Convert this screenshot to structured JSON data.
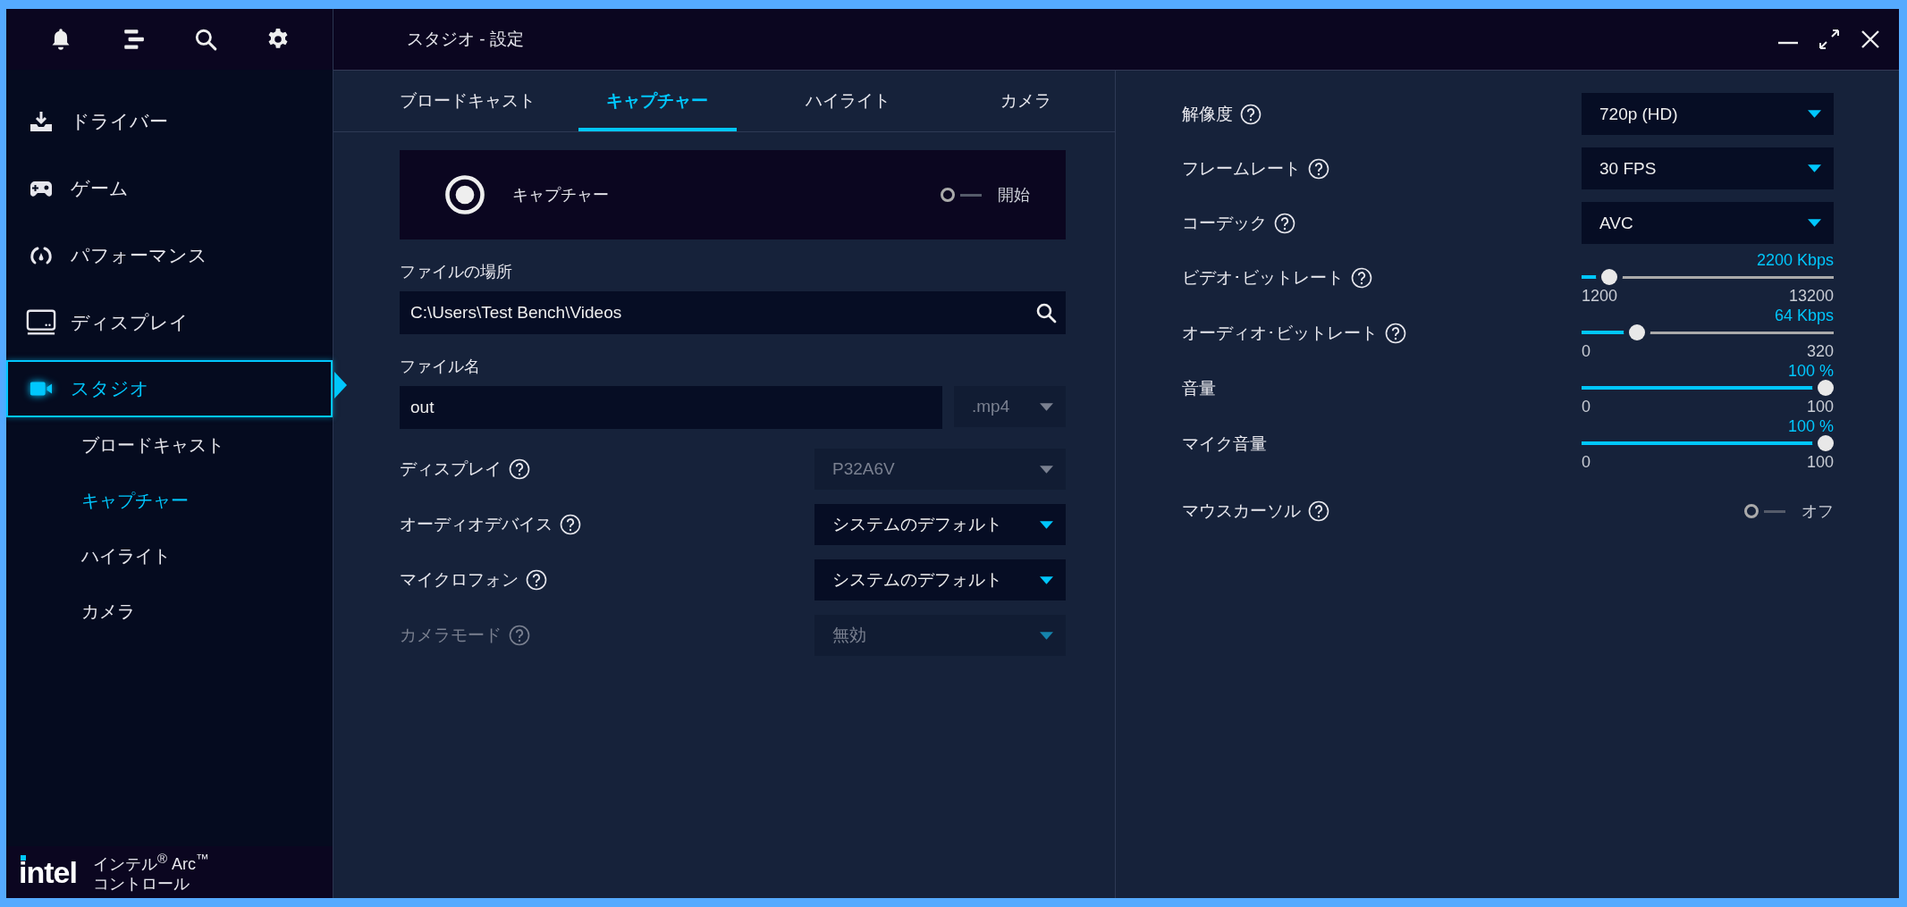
{
  "window": {
    "title": "スタジオ - 設定"
  },
  "sidebar": {
    "items": [
      {
        "label": "ドライバー",
        "selected": false
      },
      {
        "label": "ゲーム",
        "selected": false
      },
      {
        "label": "パフォーマンス",
        "selected": false
      },
      {
        "label": "ディスプレイ",
        "selected": false
      },
      {
        "label": "スタジオ",
        "selected": true,
        "children": [
          {
            "label": "ブロードキャスト",
            "selected": false
          },
          {
            "label": "キャプチャー",
            "selected": true
          },
          {
            "label": "ハイライト",
            "selected": false
          },
          {
            "label": "カメラ",
            "selected": false
          }
        ]
      }
    ],
    "brand": {
      "logo": "intel",
      "product": [
        "インテル$^{®}$ Arc$^{™}$",
        "コントロール"
      ]
    }
  },
  "tabs": [
    {
      "label": "ブロードキャスト",
      "selected": false
    },
    {
      "label": "キャプチャー",
      "selected": true
    },
    {
      "label": "ハイライト",
      "selected": false
    },
    {
      "label": "カメラ",
      "selected": false
    }
  ],
  "capture": {
    "label": "キャプチャー",
    "on": false,
    "toggle_label": "開始"
  },
  "file_location": {
    "label": "ファイルの場所",
    "value": "C:\\Users\\Test Bench\\Videos"
  },
  "file_name": {
    "label": "ファイル名",
    "value": "out",
    "extension": ".mp4",
    "extension_disabled": true
  },
  "capture_settings": [
    {
      "label": "ディスプレイ",
      "help": true,
      "label_disabled": false,
      "value": "P32A6V",
      "disabled": true
    },
    {
      "label": "オーディオデバイス",
      "help": true,
      "label_disabled": false,
      "value": "システムのデフォルト",
      "disabled": false
    },
    {
      "label": "マイクロフォン",
      "help": true,
      "label_disabled": false,
      "value": "システムのデフォルト",
      "disabled": false
    },
    {
      "label": "カメラモード",
      "help": true,
      "label_disabled": true,
      "value": "無効",
      "disabled": true
    }
  ],
  "output_settings": [
    {
      "kind": "dropdown",
      "label": "解像度",
      "help": true,
      "value": "720p (HD)"
    },
    {
      "kind": "dropdown",
      "label": "フレームレート",
      "help": true,
      "value": "30 FPS"
    },
    {
      "kind": "dropdown",
      "label": "コーデック",
      "help": true,
      "value": "AVC"
    },
    {
      "kind": "slider",
      "label": "ビデオ･ビットレート",
      "help": true,
      "reading": "2200 Kbps",
      "min": "1200",
      "max": "13200",
      "level": 0.083
    },
    {
      "kind": "slider",
      "label": "オーディオ･ビットレート",
      "help": true,
      "reading": "64 Kbps",
      "min": "0",
      "max": "320",
      "level": 0.2
    },
    {
      "kind": "slider",
      "label": "音量",
      "help": false,
      "reading": "100 %",
      "min": "0",
      "max": "100",
      "level": 1
    },
    {
      "kind": "slider",
      "label": "マイク音量",
      "help": false,
      "reading": "100 %",
      "min": "0",
      "max": "100",
      "level": 1
    },
    {
      "kind": "toggle",
      "label": "マウスカーソル",
      "help": true,
      "on": false,
      "toggle_label": "オフ"
    }
  ]
}
